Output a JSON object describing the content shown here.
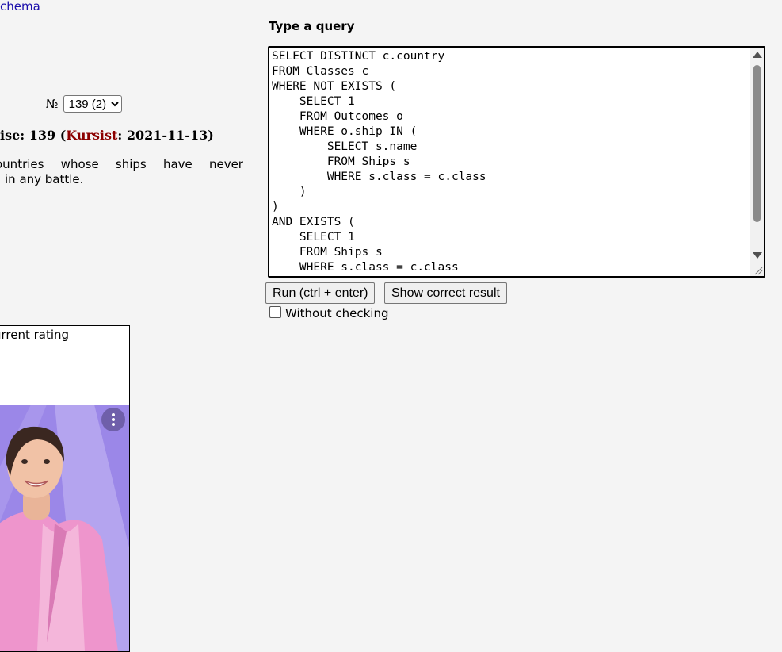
{
  "header": {
    "schema_link": "chema"
  },
  "exercise": {
    "number_symbol": "№",
    "number_select": "139 (2)",
    "title_prefix": "ise: 139 (",
    "author": "Kursist",
    "title_suffix": ": 2021-11-13)",
    "text_line1": [
      "ountries",
      "whose",
      "ships",
      "have",
      "never"
    ],
    "text_line2": "in any battle."
  },
  "query": {
    "label": "Type a query",
    "sql": "SELECT DISTINCT c.country\nFROM Classes c\nWHERE NOT EXISTS (\n    SELECT 1\n    FROM Outcomes o\n    WHERE o.ship IN (\n        SELECT s.name\n        FROM Ships s\n        WHERE s.class = c.class\n    )\n)\nAND EXISTS (\n    SELECT 1\n    FROM Ships s\n    WHERE s.class = c.class"
  },
  "buttons": {
    "run_label": "Run (ctrl + enter)",
    "show_label": "Show correct result"
  },
  "options": {
    "without_checking_label": "Without checking",
    "without_checking_checked": false
  },
  "rating": {
    "label": "urrent rating"
  },
  "colors": {
    "author": "#8b0000",
    "link": "#1a0dab",
    "ad_background": "#9a86e6"
  }
}
